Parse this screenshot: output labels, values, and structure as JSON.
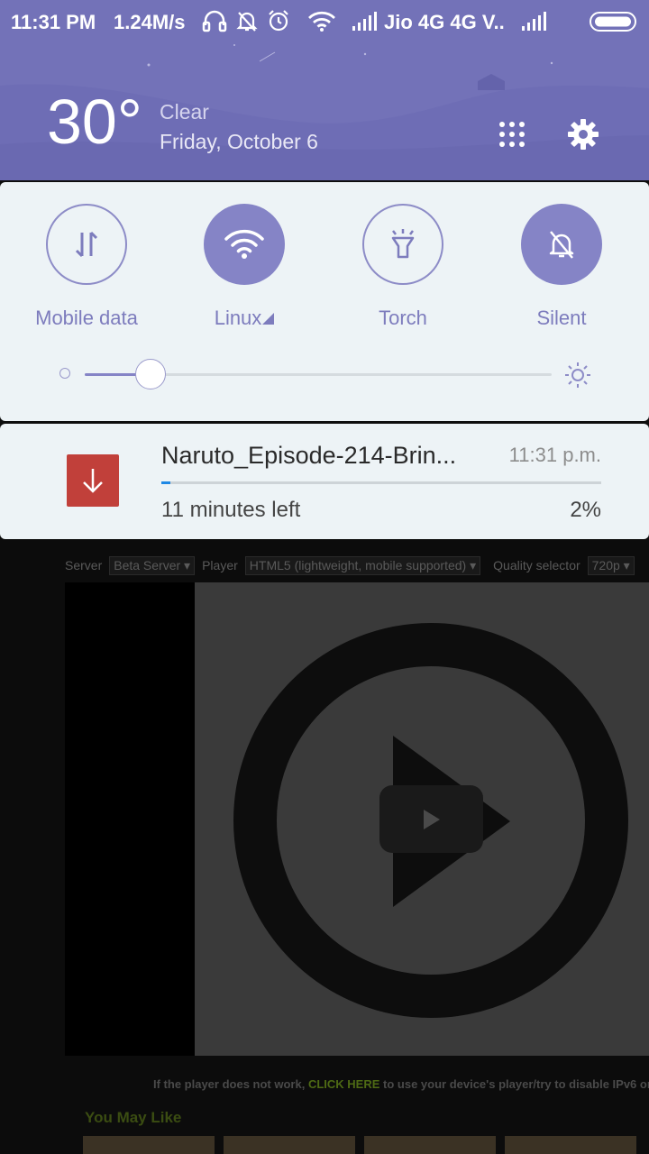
{
  "status_bar": {
    "time": "11:31 PM",
    "net_speed": "1.24M/s",
    "carrier": "Jio 4G 4G V..",
    "icons": [
      "headphones-icon",
      "bell-off-icon",
      "alarm-icon",
      "wifi-icon",
      "signal-icon",
      "signal-icon",
      "battery-icon"
    ]
  },
  "weather": {
    "temperature": "30°",
    "condition": "Clear",
    "date": "Friday, October 6"
  },
  "header_buttons": [
    "grid-icon",
    "gear-icon"
  ],
  "quick_settings": {
    "tiles": [
      {
        "label": "Mobile data",
        "icon": "mobile-data-icon",
        "active": false
      },
      {
        "label": "Linux",
        "icon": "wifi-icon",
        "active": true
      },
      {
        "label": "Torch",
        "icon": "flashlight-icon",
        "active": false
      },
      {
        "label": "Silent",
        "icon": "bell-off-icon",
        "active": true
      }
    ],
    "brightness_level": 0.14
  },
  "notification": {
    "title": "Naruto_Episode-214-Brin...",
    "time": "11:31 p.m.",
    "subtitle": "11 minutes left",
    "percent": "2%",
    "progress": 0.02,
    "icon": "download-icon",
    "icon_color": "#c1403a"
  },
  "background_page": {
    "server_label": "Server",
    "server_value": "Beta Server",
    "player_label": "Player",
    "player_value": "HTML5 (lightweight, mobile supported)",
    "quality_label": "Quality selector",
    "quality_value": "720p",
    "error_text_before": "If the player does not work,",
    "error_link": "CLICK HERE",
    "error_text_after": "to use your device's player/try to disable IPv6 or cha",
    "you_may_like": "You May Like"
  },
  "colors": {
    "accent": "#8584c6",
    "header_bg": "#7372b8",
    "panel_bg": "#edf3f6"
  }
}
